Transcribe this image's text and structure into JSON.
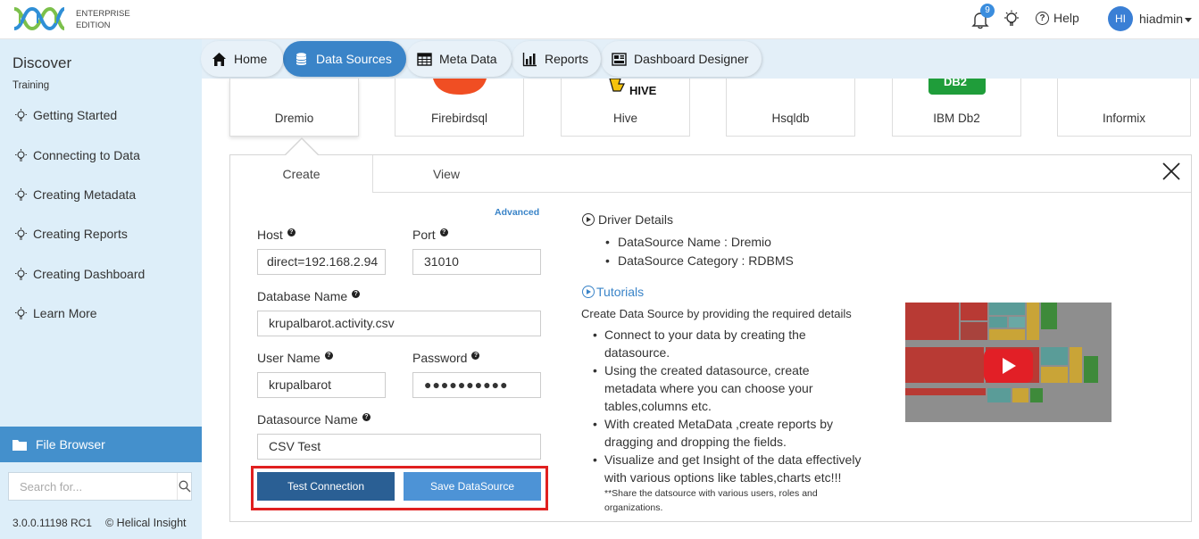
{
  "header": {
    "edition_line1": "ENTERPRISE",
    "edition_line2": "EDITION",
    "notification_count": "9",
    "help_label": "Help",
    "avatar_initials": "HI",
    "username": "hiadmin"
  },
  "sidebar": {
    "title": "Discover",
    "subtitle": "Training",
    "items": [
      {
        "label": "Getting Started"
      },
      {
        "label": "Connecting to Data"
      },
      {
        "label": "Creating Metadata"
      },
      {
        "label": "Creating Reports"
      },
      {
        "label": "Creating Dashboard"
      },
      {
        "label": "Learn More"
      }
    ],
    "file_browser_label": "File Browser",
    "search_placeholder": "Search for...",
    "version": "3.0.0.11198 RC1",
    "copyright": "© Helical Insight"
  },
  "nav": {
    "tabs": [
      {
        "label": "Home"
      },
      {
        "label": "Data Sources"
      },
      {
        "label": "Meta Data"
      },
      {
        "label": "Reports"
      },
      {
        "label": "Dashboard Designer"
      }
    ],
    "active_tab": "Data Sources"
  },
  "datasource_cards": [
    {
      "label": "Dremio"
    },
    {
      "label": "Firebirdsql"
    },
    {
      "label": "Hive"
    },
    {
      "label": "Hsqldb"
    },
    {
      "label": "IBM Db2"
    },
    {
      "label": "Informix"
    }
  ],
  "card_logo_texts": {
    "hive": "HIVE",
    "db2": "DB2"
  },
  "panel": {
    "tab_create": "Create",
    "tab_view": "View",
    "advanced_link": "Advanced",
    "form": {
      "host_label": "Host",
      "host_value": "direct=192.168.2.94",
      "port_label": "Port",
      "port_value": "31010",
      "database_label": "Database Name",
      "database_value": "krupalbarot.activity.csv",
      "username_label": "User Name",
      "username_value": "krupalbarot",
      "password_label": "Password",
      "password_value": "●●●●●●●●●●",
      "datasource_name_label": "Datasource Name",
      "datasource_name_value": "CSV Test"
    },
    "buttons": {
      "test_connection": "Test Connection",
      "save_datasource": "Save DataSource"
    },
    "driver_details": {
      "title": "Driver Details",
      "name": "DataSource Name : Dremio",
      "category": "DataSource Category : RDBMS"
    },
    "tutorials": {
      "title": "Tutorials",
      "intro": "Create Data Source by providing the required details",
      "items": [
        "Connect to your data by creating the datasource.",
        "Using the created datasource, create metadata where you can choose your tables,columns etc.",
        "With created MetaData ,create reports by dragging and dropping the fields.",
        "Visualize and get Insight of the data effectively with various options like tables,charts etc!!!"
      ],
      "note": "**Share the datsource with various users, roles and organizations."
    }
  },
  "colors": {
    "accent": "#3a84c8",
    "sidebar_bg": "#ddeef9",
    "test_button": "#2a5f94",
    "save_button": "#4d93d6",
    "highlight": "#e02020"
  }
}
